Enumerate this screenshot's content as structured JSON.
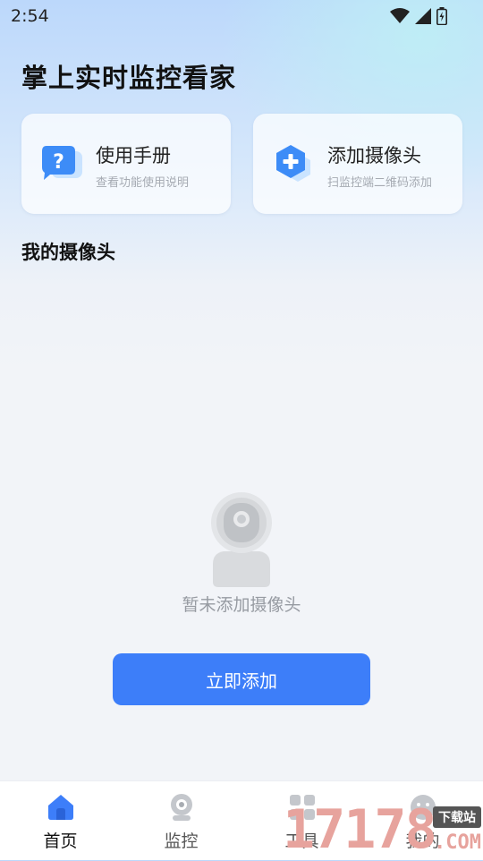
{
  "status_bar": {
    "time": "2:54"
  },
  "page_title": "掌上实时监控看家",
  "cards": [
    {
      "title": "使用手册",
      "subtitle": "查看功能使用说明",
      "icon": "help-question-icon"
    },
    {
      "title": "添加摄像头",
      "subtitle": "扫监控端二维码添加",
      "icon": "add-hexagon-icon"
    }
  ],
  "section_title": "我的摄像头",
  "empty_state": {
    "text": "暂未添加摄像头",
    "icon": "camera-illustration-icon"
  },
  "add_button": "立即添加",
  "bottom_nav": [
    {
      "label": "首页",
      "icon": "home-icon",
      "active": true
    },
    {
      "label": "监控",
      "icon": "camera-icon",
      "active": false
    },
    {
      "label": "工具",
      "icon": "tools-icon",
      "active": false
    },
    {
      "label": "我的",
      "icon": "profile-icon",
      "active": false
    }
  ],
  "watermark": {
    "digits": "17178",
    "badge": "下载站",
    "suffix": ".COM"
  },
  "colors": {
    "accent": "#3d7ef9",
    "title_text": "#111111",
    "muted_text": "#979ba2"
  }
}
